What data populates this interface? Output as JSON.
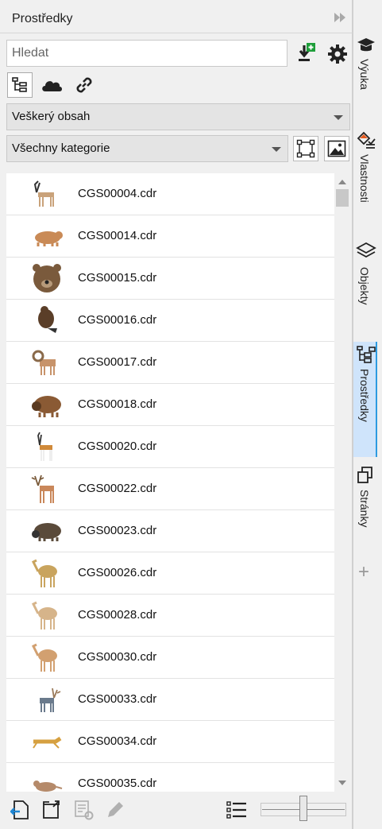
{
  "window": {
    "title": "Prostředky"
  },
  "search": {
    "placeholder": "Hledat"
  },
  "filters": {
    "content_scope": "Veškerý obsah",
    "category": "Všechny kategorie"
  },
  "files": [
    {
      "name": "CGS00004.cdr",
      "thumb": "pronghorn-icon",
      "color": "#c9a27a"
    },
    {
      "name": "CGS00014.cdr",
      "thumb": "bear-icon",
      "color": "#c98a56"
    },
    {
      "name": "CGS00015.cdr",
      "thumb": "bear-head-icon",
      "color": "#7a5a3c"
    },
    {
      "name": "CGS00016.cdr",
      "thumb": "beaver-icon",
      "color": "#5a3e28"
    },
    {
      "name": "CGS00017.cdr",
      "thumb": "bighorn-sheep-icon",
      "color": "#c7936a"
    },
    {
      "name": "CGS00018.cdr",
      "thumb": "bison-icon",
      "color": "#8a5a34"
    },
    {
      "name": "CGS00020.cdr",
      "thumb": "gazelle-icon",
      "color": "#d08a3a"
    },
    {
      "name": "CGS00022.cdr",
      "thumb": "deer-icon",
      "color": "#c9875a"
    },
    {
      "name": "CGS00023.cdr",
      "thumb": "buffalo-icon",
      "color": "#5a4a3a"
    },
    {
      "name": "CGS00026.cdr",
      "thumb": "camel-icon",
      "color": "#c9a45e"
    },
    {
      "name": "CGS00028.cdr",
      "thumb": "camel-icon",
      "color": "#d6b48a"
    },
    {
      "name": "CGS00030.cdr",
      "thumb": "camel-icon",
      "color": "#d2a070"
    },
    {
      "name": "CGS00033.cdr",
      "thumb": "reindeer-icon",
      "color": "#6a7a8c"
    },
    {
      "name": "CGS00034.cdr",
      "thumb": "cheetah-icon",
      "color": "#d6a040"
    },
    {
      "name": "CGS00035.cdr",
      "thumb": "rodent-icon",
      "color": "#b58a6a"
    }
  ],
  "side_tabs": [
    {
      "label": "Výuka",
      "icon": "graduation-cap-icon"
    },
    {
      "label": "Vlastnosti",
      "icon": "properties-icon"
    },
    {
      "label": "Objekty",
      "icon": "layers-icon"
    },
    {
      "label": "Prostředky",
      "icon": "assets-icon"
    },
    {
      "label": "Stránky",
      "icon": "pages-icon"
    }
  ],
  "colors": {
    "active_tab_bg": "#cfe4fb",
    "active_tab_accent": "#2d9be0",
    "add_badge": "#1e9e3a"
  }
}
